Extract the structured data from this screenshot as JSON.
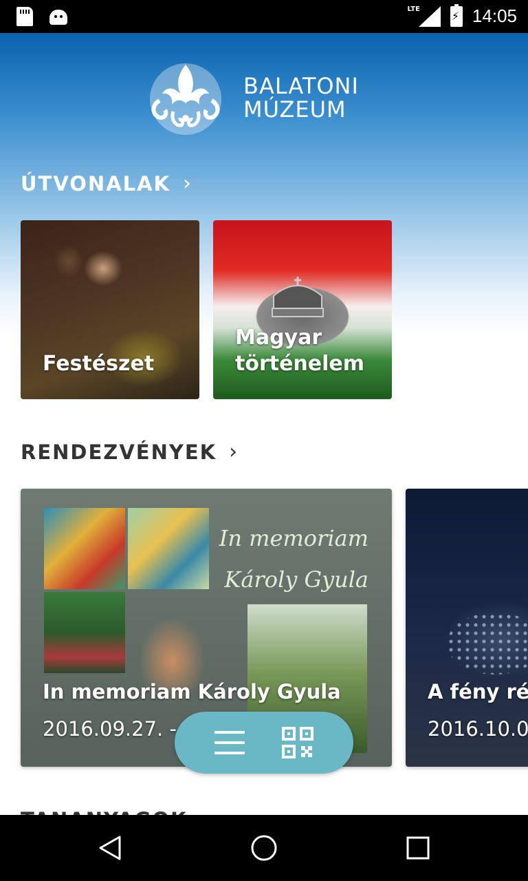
{
  "status_bar": {
    "network": "LTE",
    "time": "14:05",
    "icons": [
      "sd-card-icon",
      "android-icon",
      "signal-icon",
      "battery-charging-icon"
    ]
  },
  "logo": {
    "line1": "BALATONI",
    "line2": "MÚZEUM"
  },
  "sections": {
    "routes": {
      "title": "ÚTVONALAK",
      "cards": [
        {
          "label": "Festészet"
        },
        {
          "label_line1": "Magyar",
          "label_line2": "történelem"
        }
      ]
    },
    "events": {
      "title": "RENDEZVÉNYEK",
      "cards": [
        {
          "poster_line1": "In memoriam",
          "poster_line2": "Károly Gyula",
          "title": "In memoriam Károly Gyula",
          "date": "2016.09.27. -"
        },
        {
          "title": "A fény rég",
          "date": "2016.10.0"
        }
      ]
    },
    "materials": {
      "title": "TANANYAGOK"
    }
  },
  "fab": {
    "icons": [
      "menu-icon",
      "qr-code-icon"
    ]
  },
  "nav_bar": {
    "icons": [
      "back-icon",
      "home-icon",
      "recents-icon"
    ]
  },
  "colors": {
    "header_blue": "#0a62ad",
    "fab_teal": "#6ab8c6",
    "section_text": "#333333"
  }
}
